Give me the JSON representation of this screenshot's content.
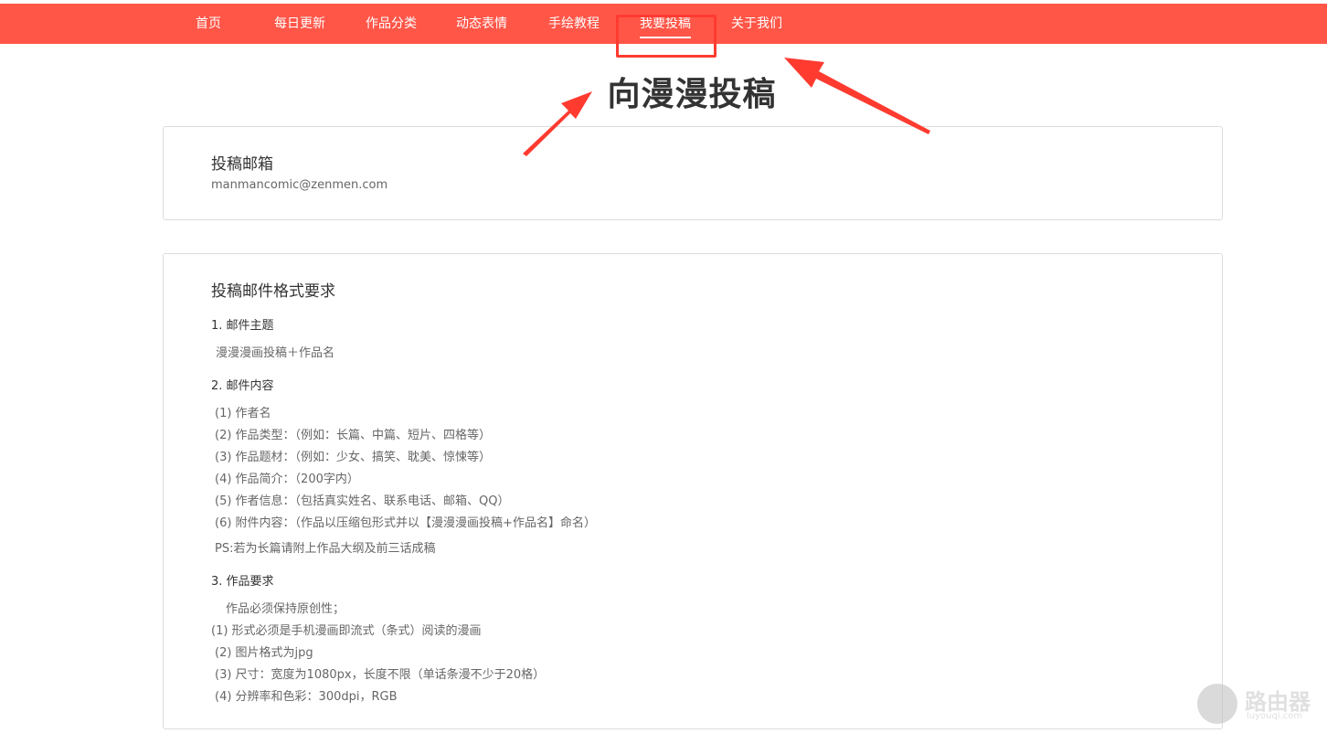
{
  "nav": {
    "items": [
      {
        "label": "首页"
      },
      {
        "label": "每日更新"
      },
      {
        "label": "作品分类"
      },
      {
        "label": "动态表情"
      },
      {
        "label": "手绘教程"
      },
      {
        "label": "我要投稿",
        "active": true
      },
      {
        "label": "关于我们"
      }
    ],
    "bar_color": "#ff5648"
  },
  "page": {
    "title": "向漫漫投稿"
  },
  "email_card": {
    "heading": "投稿邮箱",
    "address": "manmancomic@zenmen.com"
  },
  "format_card": {
    "heading": "投稿邮件格式要求",
    "section1": {
      "title": "1. 邮件主题",
      "lines": [
        "漫漫漫画投稿＋作品名"
      ]
    },
    "section2": {
      "title": "2. 邮件内容",
      "lines": [
        "(1) 作者名",
        "(2) 作品类型：（例如：长篇、中篇、短片、四格等）",
        "(3) 作品题材：（例如：少女、搞笑、耽美、惊悚等）",
        "(4) 作品简介：（200字内）",
        "(5) 作者信息：（包括真实姓名、联系电话、邮箱、QQ）",
        "(6) 附件内容：（作品以压缩包形式并以【漫漫漫画投稿+作品名】命名）"
      ],
      "ps": "PS:若为长篇请附上作品大纲及前三话成稿"
    },
    "section3": {
      "title": "3. 作品要求",
      "intro": "作品必须保持原创性；",
      "lines": [
        "(1) 形式必须是手机漫画即流式（条式）阅读的漫画",
        "(2) 图片格式为jpg",
        "(3) 尺寸：宽度为1080px，长度不限（单话条漫不少于20格）",
        "(4) 分辨率和色彩：300dpi，RGB"
      ]
    }
  },
  "watermark": {
    "text": "路由器",
    "sub": "luyouqi.com"
  },
  "annotation_color": "#ff3b30"
}
